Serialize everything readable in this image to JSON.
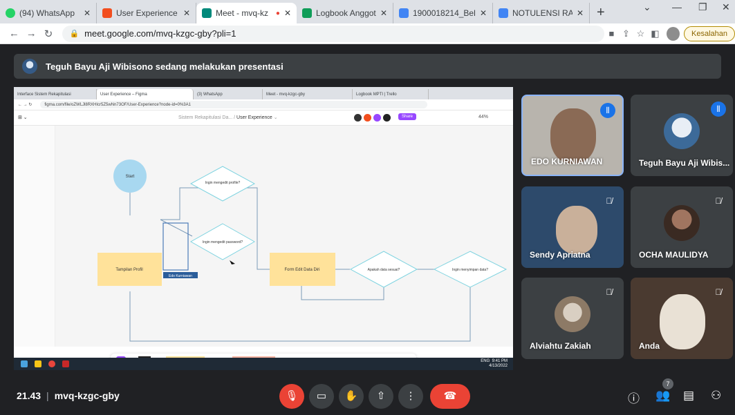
{
  "browser": {
    "tabs": [
      {
        "label": "(94) WhatsApp",
        "color": "#25d366"
      },
      {
        "label": "User Experience – F",
        "color": "#f24e1e"
      },
      {
        "label": "Meet - mvq-kz",
        "color": "#00897b",
        "active": true
      },
      {
        "label": "Logbook Anggota",
        "color": "#0f9d58"
      },
      {
        "label": "1900018214_Bella",
        "color": "#4285f4"
      },
      {
        "label": "NOTULENSI RAPAT",
        "color": "#4285f4"
      }
    ],
    "url": "meet.google.com/mvq-kzgc-gby?pli=1",
    "error_chip": "Kesalahan"
  },
  "meet": {
    "banner": "Teguh Bayu Aji Wibisono sedang melakukan presentasi",
    "time": "21.43",
    "meeting_code": "mvq-kzgc-gby",
    "participant_count": "7",
    "accent": "#1a73e8",
    "danger": "#ea4335"
  },
  "shared_screen": {
    "tabs": [
      "Interface Sistem Rekapitulasi",
      "User Experience – Figma",
      "(3) WhatsApp",
      "Meet - mvq-kzgc-gby",
      "Logbook MPTI | Trello"
    ],
    "url": "figma.com/file/oZWLJl8RXHIcr5Z5wNn73OF/User-Experience?node-id=0%3A1",
    "file_path": "Sistem Rekapitulasi Da...",
    "page_name": "User Experience",
    "share_label": "Share",
    "zoom": "44%",
    "flow": {
      "start": "Start",
      "edit_profile_q": "Ingin mengedit profile?",
      "edit_password_q": "Ingin mengedit password?",
      "tampilan_profil": "Tampilan Profil",
      "form_edit": "Form Edit Data Diri",
      "data_sesuai_q": "Apakah data sesuai?",
      "simpan_q": "Ingin menyimpan data?",
      "cursor_label": "Edo Kurniawan"
    },
    "taskbar_time": "9:41 PM",
    "taskbar_date": "4/13/2022",
    "taskbar_lang": "ENG"
  },
  "participants": [
    {
      "name": "EDO KURNIAWAN",
      "speaking": true
    },
    {
      "name": "Teguh Bayu Aji Wibis...",
      "speaking": true
    },
    {
      "name": "Sendy Apriatna",
      "muted": true
    },
    {
      "name": "OCHA MAULIDYA",
      "muted": true
    },
    {
      "name": "Alviahtu Zakiah",
      "muted": true
    },
    {
      "name": "Anda",
      "muted": true
    }
  ]
}
